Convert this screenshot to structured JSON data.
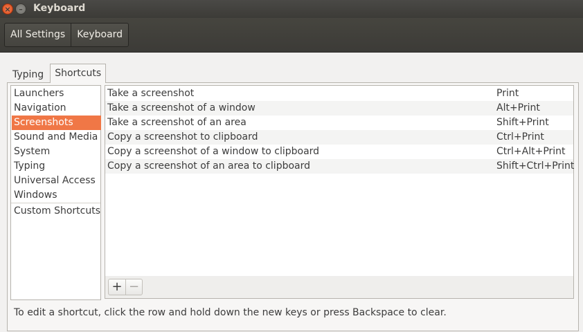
{
  "window": {
    "title": "Keyboard",
    "close_glyph": "×",
    "minimize_glyph": "–"
  },
  "breadcrumbs": [
    "All Settings",
    "Keyboard"
  ],
  "tabs": [
    "Typing",
    "Shortcuts"
  ],
  "active_tab": "Shortcuts",
  "categories": [
    "Launchers",
    "Navigation",
    "Screenshots",
    "Sound and Media",
    "System",
    "Typing",
    "Universal Access",
    "Windows",
    "Custom Shortcuts"
  ],
  "selected_category": "Screenshots",
  "shortcuts": [
    {
      "name": "Take a screenshot",
      "key": "Print"
    },
    {
      "name": "Take a screenshot of a window",
      "key": "Alt+Print"
    },
    {
      "name": "Take a screenshot of an area",
      "key": "Shift+Print"
    },
    {
      "name": "Copy a screenshot to clipboard",
      "key": "Ctrl+Print"
    },
    {
      "name": "Copy a screenshot of a window to clipboard",
      "key": "Ctrl+Alt+Print"
    },
    {
      "name": "Copy a screenshot of an area to clipboard",
      "key": "Shift+Ctrl+Print"
    }
  ],
  "toolbar_buttons": {
    "add": "+",
    "remove": "−"
  },
  "hint": "To edit a shortcut, click the row and hold down the new keys or press Backspace to clear.",
  "colors": {
    "accent": "#f07746",
    "titlebar": "#3c3b37"
  }
}
